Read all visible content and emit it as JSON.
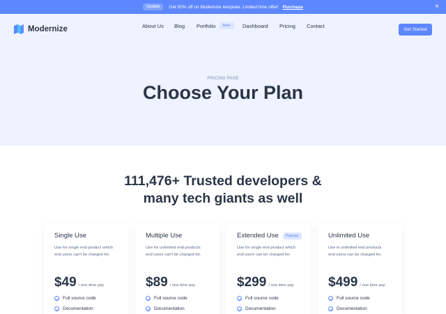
{
  "announcement": {
    "badge": "Update",
    "text": "Get 50% off on Modernize template. Limited time offer!",
    "link": "Purchase",
    "close_icon": "close-icon"
  },
  "header": {
    "logo_text": "Modernize",
    "logo_icon": "modernize-logo-icon",
    "nav": [
      {
        "label": "About Us"
      },
      {
        "label": "Blog"
      },
      {
        "label": "Portfolio",
        "badge": "New"
      },
      {
        "label": "Dashboard"
      },
      {
        "label": "Pricing"
      },
      {
        "label": "Contact"
      }
    ],
    "cta": "Get Started"
  },
  "hero": {
    "eyebrow": "PRICING PAGE",
    "title": "Choose Your Plan"
  },
  "trusted": {
    "line1": "111,476+ Trusted developers &",
    "line2": "many tech giants as well"
  },
  "plans": [
    {
      "name": "Single Use",
      "badge": "",
      "desc1": "Use for single end product which",
      "desc2": "end users can't be charged for.",
      "price": "$49",
      "per": "/ one time pay",
      "features": [
        "Full source code",
        "Documentation"
      ]
    },
    {
      "name": "Multiple Use",
      "badge": "",
      "desc1": "Use for unlimited end products",
      "desc2": "end users can't be charged for.",
      "price": "$89",
      "per": "/ one time pay",
      "features": [
        "Full source code",
        "Documentation"
      ]
    },
    {
      "name": "Extended Use",
      "badge": "Popular",
      "desc1": "Use for single end product which",
      "desc2": "end users can be charged for.",
      "price": "$299",
      "per": "/ one time pay",
      "features": [
        "Full source code",
        "Documentation"
      ]
    },
    {
      "name": "Unlimited Use",
      "badge": "",
      "desc1": "Use in unlimited end products",
      "desc2": "end users can be charged for.",
      "price": "$499",
      "per": "/ one time pay",
      "features": [
        "Full source code",
        "Documentation"
      ]
    }
  ],
  "colors": {
    "primary": "#5d87ff",
    "hero_bg": "#eef3ff",
    "text_dark": "#2a3547",
    "text_muted": "#5a6a85"
  }
}
